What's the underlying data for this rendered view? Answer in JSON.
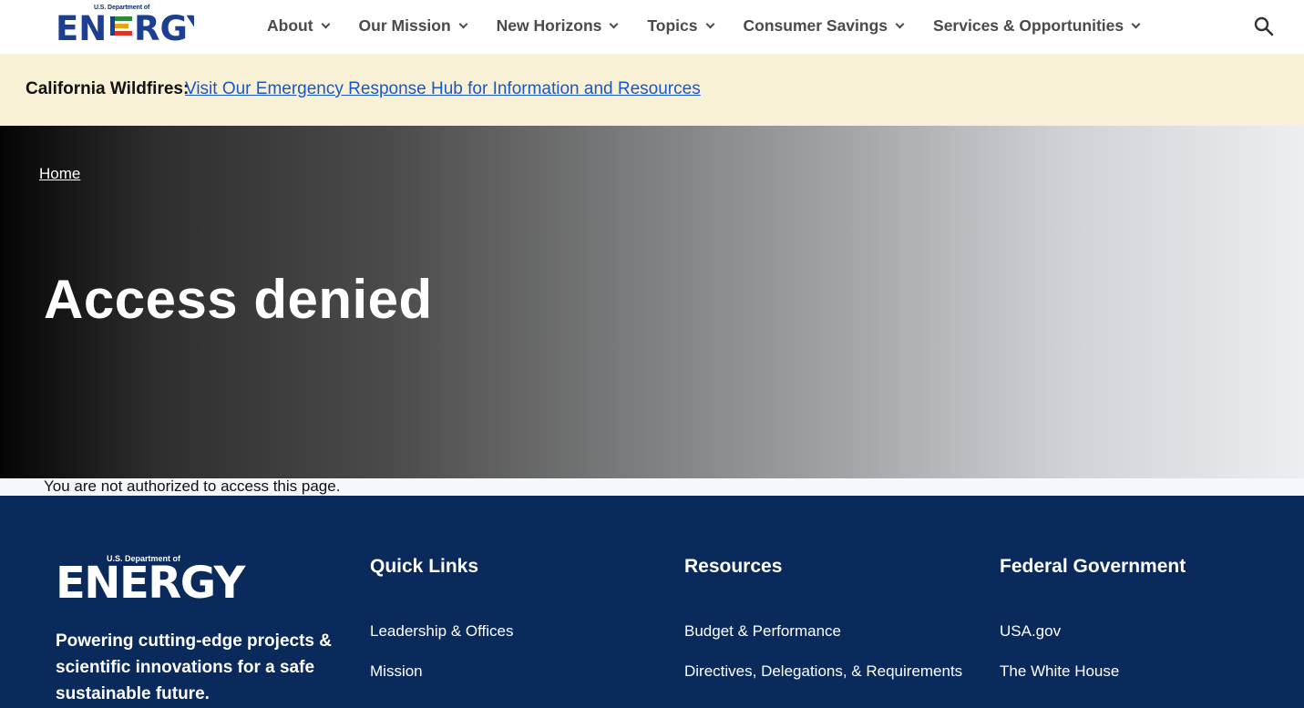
{
  "header": {
    "logo_small": "U.S. Department of",
    "logo_word": "ENERGY",
    "nav": [
      {
        "label": "About"
      },
      {
        "label": "Our Mission"
      },
      {
        "label": "New Horizons"
      },
      {
        "label": "Topics"
      },
      {
        "label": "Consumer Savings"
      },
      {
        "label": "Services & Opportunities"
      }
    ],
    "search_icon": "search-icon"
  },
  "alert": {
    "label": "California Wildfires:",
    "link": "Visit Our Emergency Response Hub for Information and Resources"
  },
  "hero": {
    "breadcrumb": "Home",
    "title": "Access denied"
  },
  "message": "You are not authorized to access this page.",
  "footer": {
    "logo_small": "U.S. Department of",
    "logo_word": "ENERGY",
    "tagline": "Powering cutting-edge projects & scientific innovations for a safe sustainable future.",
    "columns": [
      {
        "title": "Quick Links",
        "links": [
          "Leadership & Offices",
          "Mission"
        ]
      },
      {
        "title": "Resources",
        "links": [
          "Budget & Performance",
          "Directives, Delegations, & Requirements"
        ]
      },
      {
        "title": "Federal Government",
        "links": [
          "USA.gov",
          "The White House"
        ]
      }
    ]
  },
  "colors": {
    "footer_bg": "#0a2a5c",
    "alert_bg": "#f8f1d6",
    "link": "#1a57c9"
  }
}
